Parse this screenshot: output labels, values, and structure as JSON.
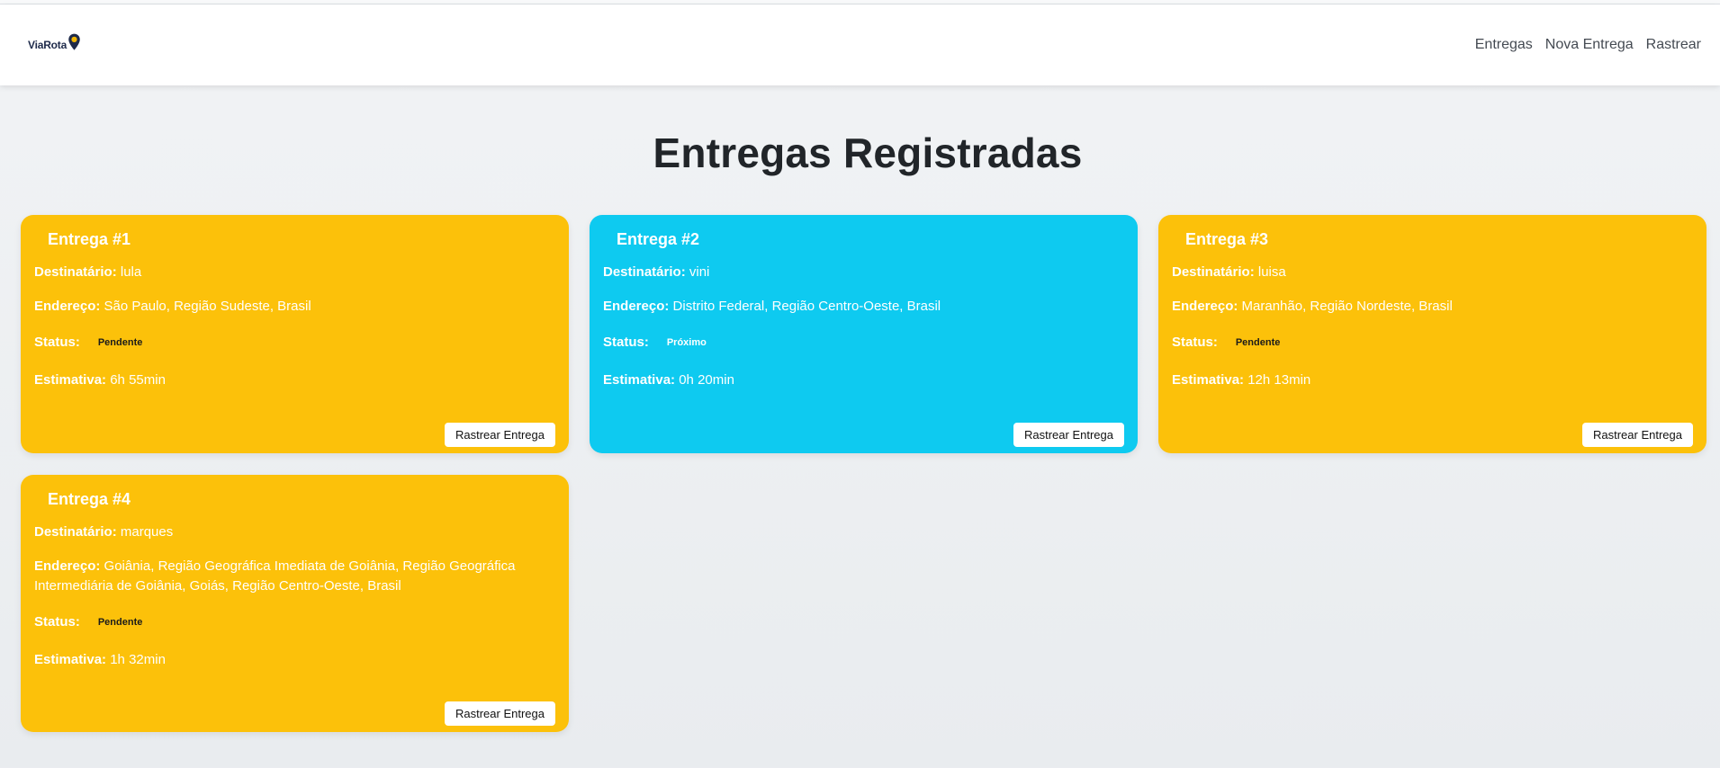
{
  "brand": {
    "name": "ViaRota"
  },
  "nav": {
    "links": [
      "Entregas",
      "Nova Entrega",
      "Rastrear"
    ]
  },
  "page": {
    "title": "Entregas Registradas"
  },
  "labels": {
    "recipient": "Destinatário:",
    "address": "Endereço:",
    "status": "Status:",
    "estimate": "Estimativa:",
    "track_button": "Rastrear Entrega"
  },
  "colors": {
    "pending": "#fcc10a",
    "near": "#0ecaf0"
  },
  "deliveries": [
    {
      "title": "Entrega #1",
      "recipient": "lula",
      "address": "São Paulo, Região Sudeste, Brasil",
      "status": "Pendente",
      "estimate": "6h 55min",
      "color": "pending"
    },
    {
      "title": "Entrega #2",
      "recipient": "vini",
      "address": "Distrito Federal, Região Centro-Oeste, Brasil",
      "status": "Próximo",
      "estimate": "0h 20min",
      "color": "near"
    },
    {
      "title": "Entrega #3",
      "recipient": "luisa",
      "address": "Maranhão, Região Nordeste, Brasil",
      "status": "Pendente",
      "estimate": "12h 13min",
      "color": "pending"
    },
    {
      "title": "Entrega #4",
      "recipient": "marques",
      "address": "Goiânia, Região Geográfica Imediata de Goiânia, Região Geográfica Intermediária de Goiânia, Goiás, Região Centro-Oeste, Brasil",
      "status": "Pendente",
      "estimate": "1h 32min",
      "color": "pending"
    }
  ]
}
